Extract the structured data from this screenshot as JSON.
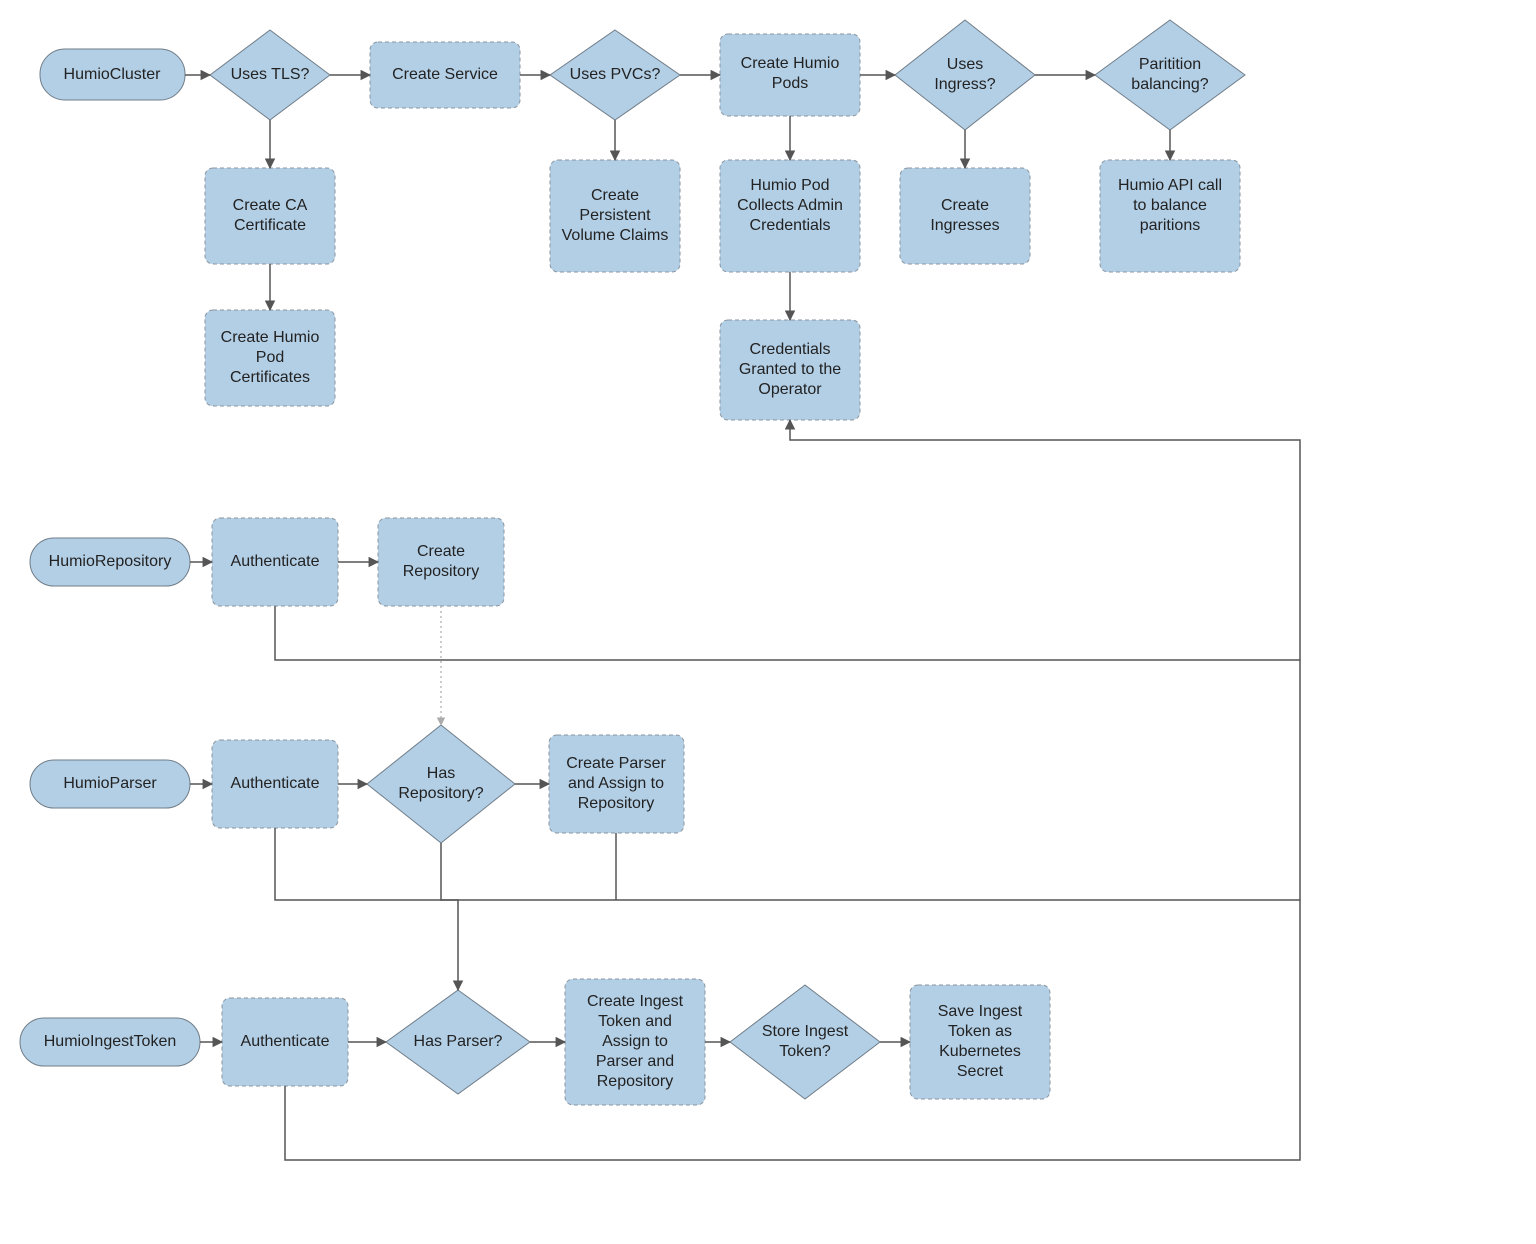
{
  "nodes": {
    "humioCluster": "HumioCluster",
    "usesTLS": "Uses TLS?",
    "createService": "Create Service",
    "usesPVCs": "Uses PVCs?",
    "createHumioPods": "Create Humio Pods",
    "usesIngress": "Uses Ingress?",
    "partitionBalancing": "Paritition balancing?",
    "createCACert": "Create CA Certificate",
    "createPVC": "Create Persistent Volume Claims",
    "humioPodCollects": "Humio Pod Collects Admin Credentials",
    "createIngresses": "Create Ingresses",
    "humioAPICall": "Humio API call to balance paritions",
    "createHumioPodCerts": "Create Humio Pod Certificates",
    "credentialsGranted": "Credentials Granted to the Operator",
    "humioRepository": "HumioRepository",
    "authRepo": "Authenticate",
    "createRepository": "Create Repository",
    "humioParser": "HumioParser",
    "authParser": "Authenticate",
    "hasRepository": "Has Repository?",
    "createParserAssign": "Create Parser and Assign to Repository",
    "humioIngestToken": "HumioIngestToken",
    "authIngest": "Authenticate",
    "hasParser": "Has Parser?",
    "createIngestToken": "Create Ingest Token and Assign to Parser and Repository",
    "storeIngestToken": "Store Ingest Token?",
    "saveIngestSecret": "Save Ingest Token as Kubernetes Secret"
  },
  "colors": {
    "nodeFill": "#b3cfe6",
    "edge": "#555"
  }
}
